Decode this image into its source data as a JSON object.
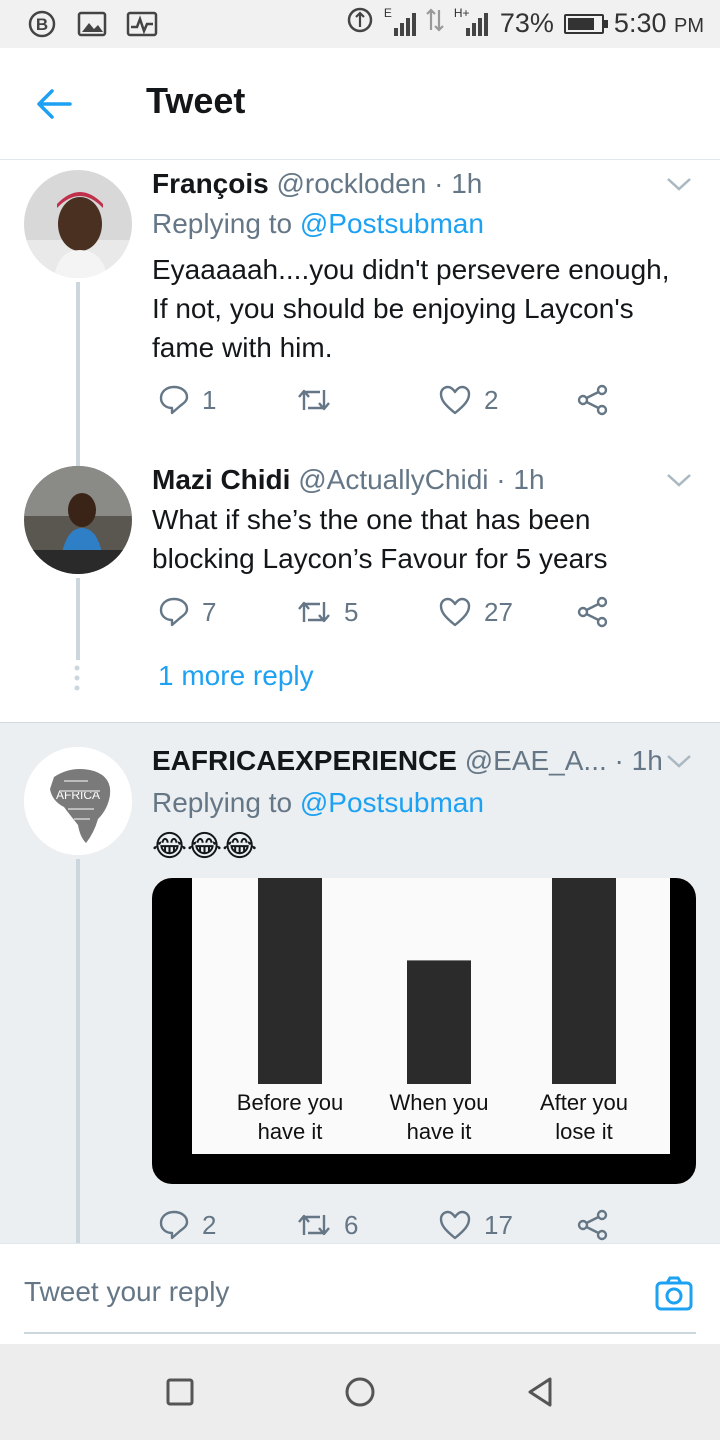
{
  "status_bar": {
    "icons_left": [
      "b-circle-icon",
      "image-icon",
      "activity-icon"
    ],
    "network_e": "E",
    "network_h": "H+",
    "battery": "73%",
    "battery_level": 0.73,
    "time": "5:30",
    "ampm": "PM"
  },
  "header": {
    "title": "Tweet"
  },
  "tweets": [
    {
      "name": "François",
      "handle": "@rockloden",
      "time": "· 1h",
      "replying_prefix": "Replying to",
      "replying_handle": "@Postsubman",
      "text_lines": [
        "Eyaaaaah....you didn't persevere enough,",
        "If not, you should be enjoying Laycon's",
        "fame with him."
      ],
      "replies": "1",
      "retweets": "",
      "likes": "2"
    },
    {
      "name": "Mazi Chidi",
      "handle": "@ActuallyChidi",
      "time": "· 1h",
      "text_lines": [
        "What if she’s the one that has been",
        "blocking Laycon’s Favour for 5 years"
      ],
      "replies": "7",
      "retweets": "5",
      "likes": "27"
    },
    {
      "name": "EAFRICAEXPERIENCE",
      "handle": "@EAE_A...",
      "time": "· 1h",
      "replying_prefix": "Replying to",
      "replying_handle": "@Postsubman",
      "emoji": "😂😂😂",
      "replies": "2",
      "retweets": "6",
      "likes": "17"
    }
  ],
  "more_reply": "1 more reply",
  "media_chart": {
    "labels": [
      [
        "Before you",
        "have it"
      ],
      [
        "When you",
        "have it"
      ],
      [
        "After you",
        "lose it"
      ]
    ],
    "values": [
      1.0,
      0.6,
      1.0
    ]
  },
  "reply_bar": {
    "placeholder": "Tweet your reply"
  },
  "colors": {
    "accent": "#1da1f2",
    "meta": "#657786",
    "text": "#14171a"
  }
}
